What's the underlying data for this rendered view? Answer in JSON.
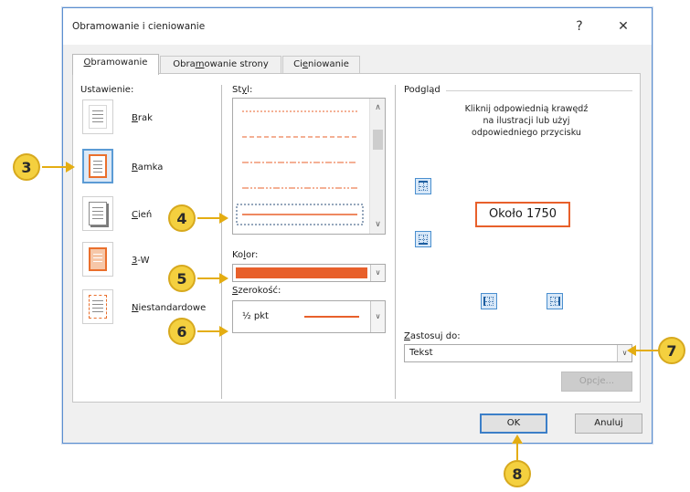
{
  "dialog": {
    "title": "Obramowanie i cieniowanie",
    "help_label": "?",
    "close_label": "✕"
  },
  "tabs": [
    {
      "prefix": "",
      "key": "O",
      "rest": "bramowanie",
      "active": true
    },
    {
      "prefix": "Obra",
      "key": "m",
      "rest": "owanie strony",
      "active": false
    },
    {
      "prefix": "Ci",
      "key": "e",
      "rest": "niowanie",
      "active": false
    }
  ],
  "settings": {
    "label": "Ustawienie:",
    "items": [
      {
        "key": "B",
        "rest": "rak",
        "selected": false
      },
      {
        "key": "R",
        "rest": "amka",
        "selected": true
      },
      {
        "key": "C",
        "rest": "ień",
        "selected": false
      },
      {
        "key": "3",
        "rest": "-W",
        "selected": false
      },
      {
        "key": "N",
        "rest": "iestandardowe",
        "selected": false
      }
    ]
  },
  "style": {
    "label_prefix": "St",
    "label_key": "y",
    "label_rest": "l:",
    "items": [
      "dotted",
      "dashed",
      "dash-dot",
      "dash-dot-dot",
      "solid"
    ],
    "selected_index": 4
  },
  "color": {
    "label_prefix": "Ko",
    "label_key": "l",
    "label_rest": "or:",
    "value": "#e8602b"
  },
  "width": {
    "label_key": "S",
    "label_rest": "zerokość:",
    "value": "½ pkt"
  },
  "preview": {
    "label": "Podgląd",
    "instructions": [
      "Kliknij odpowiednią krawędź",
      "na ilustracji lub użyj",
      "odpowiedniego przycisku"
    ],
    "sample_text": "Około 1750"
  },
  "apply_to": {
    "label_key": "Z",
    "label_rest": "astosuj do:",
    "value": "Tekst"
  },
  "buttons": {
    "options": "Opcje...",
    "ok": "OK",
    "cancel": "Anuluj"
  },
  "callouts": [
    "3",
    "4",
    "5",
    "6",
    "7",
    "8"
  ],
  "colors": {
    "accent": "#e8602b",
    "callout": "#f4d03f",
    "selection": "#5b9bd5"
  }
}
